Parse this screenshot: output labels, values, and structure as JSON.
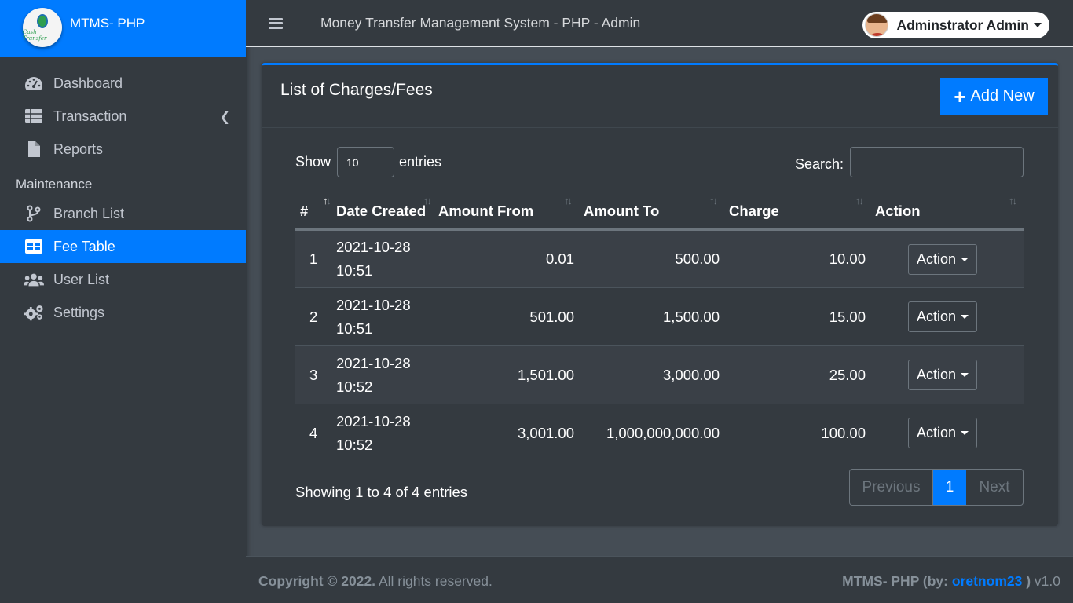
{
  "brand": {
    "name": "MTMS- PHP",
    "logo_text": "Cash Transfer"
  },
  "sidebar": {
    "items": [
      {
        "label": "Dashboard",
        "icon": "dashboard-icon"
      },
      {
        "label": "Transaction",
        "icon": "table-list-icon"
      },
      {
        "label": "Reports",
        "icon": "file-icon"
      }
    ],
    "section_header": "Maintenance",
    "maintenance_items": [
      {
        "label": "Branch List",
        "icon": "branch-icon"
      },
      {
        "label": "Fee Table",
        "icon": "table-icon",
        "active": true
      },
      {
        "label": "User List",
        "icon": "users-icon"
      },
      {
        "label": "Settings",
        "icon": "gears-icon"
      }
    ]
  },
  "topbar": {
    "system_title": "Money Transfer Management System - PHP - Admin",
    "user_name": "Adminstrator Admin"
  },
  "card": {
    "title": "List of Charges/Fees",
    "add_label": "Add New",
    "add_icon": "+"
  },
  "controls": {
    "show_label": "Show",
    "entries_value": "10",
    "entries_label": "entries",
    "search_label": "Search:"
  },
  "table": {
    "headers": [
      "#",
      "Date Created",
      "Amount From",
      "Amount To",
      "Charge",
      "Action"
    ],
    "rows": [
      {
        "no": "1",
        "date": "2021-10-28",
        "time": "10:51",
        "from": "0.01",
        "to": "500.00",
        "charge": "10.00",
        "action": "Action"
      },
      {
        "no": "2",
        "date": "2021-10-28",
        "time": "10:51",
        "from": "501.00",
        "to": "1,500.00",
        "charge": "15.00",
        "action": "Action"
      },
      {
        "no": "3",
        "date": "2021-10-28",
        "time": "10:52",
        "from": "1,501.00",
        "to": "3,000.00",
        "charge": "25.00",
        "action": "Action"
      },
      {
        "no": "4",
        "date": "2021-10-28",
        "time": "10:52",
        "from": "3,001.00",
        "to": "1,000,000,000.00",
        "charge": "100.00",
        "action": "Action"
      }
    ]
  },
  "pagination": {
    "info": "Showing 1 to 4 of 4 entries",
    "previous": "Previous",
    "current": "1",
    "next": "Next"
  },
  "footer": {
    "copyright_bold": "Copyright © 2022.",
    "copyright_rest": "All rights reserved.",
    "credit_prefix": "MTMS- PHP (by:",
    "credit_author": "oretnom23",
    "credit_suffix": ")",
    "version": "v1.0"
  },
  "colors": {
    "accent": "#007bff",
    "sidebar": "#343a40",
    "body": "#454d55"
  }
}
